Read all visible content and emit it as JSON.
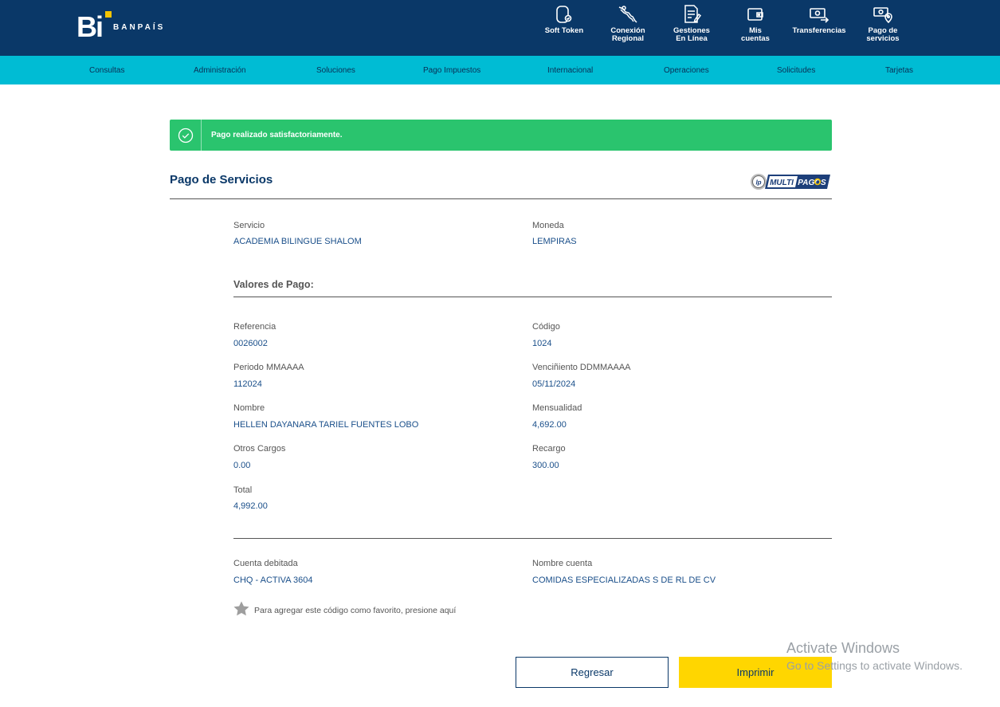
{
  "brand": {
    "logo_letters": "Bi",
    "name": "BANPAÍS"
  },
  "topnav": [
    {
      "label": "Soft Token",
      "icon": "soft-token-icon"
    },
    {
      "label": "Conexión\nRegional",
      "icon": "map-icon"
    },
    {
      "label": "Gestiones\nEn Línea",
      "icon": "document-edit-icon"
    },
    {
      "label": "Mis\ncuentas",
      "icon": "wallet-icon"
    },
    {
      "label": "Transferencias",
      "icon": "transfer-icon"
    },
    {
      "label": "Pago de\nservicios",
      "icon": "service-payment-icon"
    }
  ],
  "menu": [
    "Consultas",
    "Administración",
    "Soluciones",
    "Pago Impuestos",
    "Internacional",
    "Operaciones",
    "Solicitudes",
    "Tarjetas"
  ],
  "alert": {
    "text": "Pago realizado satisfactoriamente.",
    "color": "#2ac46e"
  },
  "page_title": "Pago de Servicios",
  "partner_logo": {
    "text": "MULTIPAGOS"
  },
  "service": {
    "servicio_label": "Servicio",
    "servicio_value": "ACADEMIA BILINGUE SHALOM",
    "moneda_label": "Moneda",
    "moneda_value": "LEMPIRAS"
  },
  "valores_title": "Valores de Pago:",
  "valores": {
    "referencia_label": "Referencia",
    "referencia_value": "0026002",
    "codigo_label": "Código",
    "codigo_value": "1024",
    "periodo_label": "Periodo MMAAAA",
    "periodo_value": "112024",
    "vencimiento_label": "Venciñiento DDMMAAAA",
    "vencimiento_value": "05/11/2024",
    "nombre_label": "Nombre",
    "nombre_value": "HELLEN DAYANARA TARIEL FUENTES LOBO",
    "mensualidad_label": "Mensualidad",
    "mensualidad_value": "4,692.00",
    "otros_label": "Otros Cargos",
    "otros_value": "0.00",
    "recargo_label": "Recargo",
    "recargo_value": "300.00",
    "total_label": "Total",
    "total_value": "4,992.00"
  },
  "account": {
    "cuenta_label": "Cuenta debitada",
    "cuenta_value": "CHQ - ACTIVA 3604",
    "nombre_cuenta_label": "Nombre cuenta",
    "nombre_cuenta_value": "COMIDAS ESPECIALIZADAS S DE RL DE CV"
  },
  "favorite_text": "Para agregar este código como favorito, presione aquí",
  "buttons": {
    "back": "Regresar",
    "print": "Imprimir"
  },
  "watermark": {
    "title": "Activate Windows",
    "subtitle": "Go to Settings to activate Windows."
  },
  "colors": {
    "header": "#0a3868",
    "menubar": "#00bcd4",
    "accent_button": "#ffd600",
    "value_text": "#1a4f8a"
  }
}
